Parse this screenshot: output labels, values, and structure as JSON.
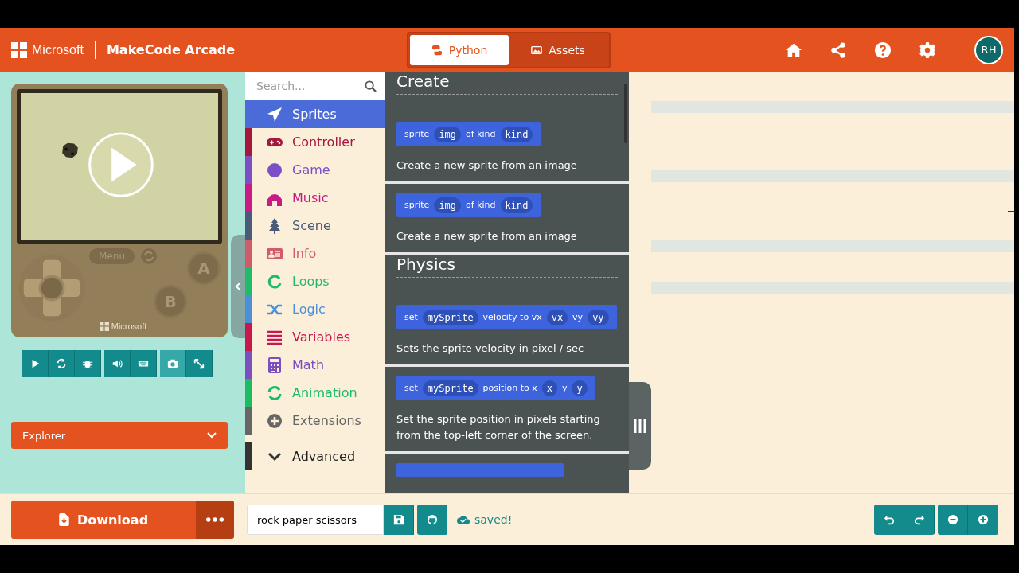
{
  "header": {
    "brand": "Microsoft",
    "title": "MakeCode Arcade",
    "tabs": [
      {
        "label": "Python",
        "selected": true
      },
      {
        "label": "Assets",
        "selected": false
      }
    ],
    "avatar": "RH"
  },
  "simulator": {
    "menu": "Menu",
    "button_a": "A",
    "button_b": "B",
    "logo": "Microsoft",
    "explorer": "Explorer"
  },
  "toolbox": {
    "search": {
      "placeholder": "Search..."
    },
    "categories": [
      {
        "label": "Sprites",
        "color": "#4b6cd8",
        "selected": true
      },
      {
        "label": "Controller",
        "color": "#a5163d",
        "selected": false
      },
      {
        "label": "Game",
        "color": "#7c4fc7",
        "selected": false
      },
      {
        "label": "Music",
        "color": "#c81b85",
        "selected": false
      },
      {
        "label": "Scene",
        "color": "#4a5b7a",
        "selected": false
      },
      {
        "label": "Info",
        "color": "#cf5b6b",
        "selected": false
      },
      {
        "label": "Loops",
        "color": "#1fbb6a",
        "selected": false
      },
      {
        "label": "Logic",
        "color": "#4a90d9",
        "selected": false
      },
      {
        "label": "Variables",
        "color": "#c8174f",
        "selected": false
      },
      {
        "label": "Math",
        "color": "#7b4fbe",
        "selected": false
      },
      {
        "label": "Animation",
        "color": "#1dbb63",
        "selected": false
      },
      {
        "label": "Extensions",
        "color": "#666666",
        "selected": false
      }
    ],
    "advanced": {
      "label": "Advanced",
      "expanded": false
    }
  },
  "flyout": {
    "sections": [
      {
        "title": "Create",
        "blocks": [
          {
            "parts": [
              {
                "kind": "text",
                "text": "sprite"
              },
              {
                "kind": "field",
                "text": "img"
              },
              {
                "kind": "text",
                "text": "of kind"
              },
              {
                "kind": "field",
                "text": "kind"
              }
            ],
            "description": "Create a new sprite from an image"
          },
          {
            "parts": [
              {
                "kind": "text",
                "text": "sprite"
              },
              {
                "kind": "field",
                "text": "img"
              },
              {
                "kind": "text",
                "text": "of kind"
              },
              {
                "kind": "field",
                "text": "kind"
              }
            ],
            "description": "Create a new sprite from an image"
          }
        ]
      },
      {
        "title": "Physics",
        "blocks": [
          {
            "parts": [
              {
                "kind": "text",
                "text": "set"
              },
              {
                "kind": "field",
                "text": "mySprite"
              },
              {
                "kind": "text",
                "text": "velocity to vx"
              },
              {
                "kind": "field",
                "text": "vx"
              },
              {
                "kind": "text",
                "text": "vy"
              },
              {
                "kind": "field",
                "text": "vy"
              }
            ],
            "description": "Sets the sprite velocity in pixel / sec"
          },
          {
            "parts": [
              {
                "kind": "text",
                "text": "set"
              },
              {
                "kind": "field",
                "text": "mySprite"
              },
              {
                "kind": "text",
                "text": "position to x"
              },
              {
                "kind": "field",
                "text": "x"
              },
              {
                "kind": "text",
                "text": "y"
              },
              {
                "kind": "field",
                "text": "y"
              }
            ],
            "description": "Set the sprite position in pixels starting from the top-left corner of the screen."
          }
        ]
      }
    ]
  },
  "footer": {
    "download": "Download",
    "project_name": "rock paper scissors",
    "status": "saved!"
  }
}
